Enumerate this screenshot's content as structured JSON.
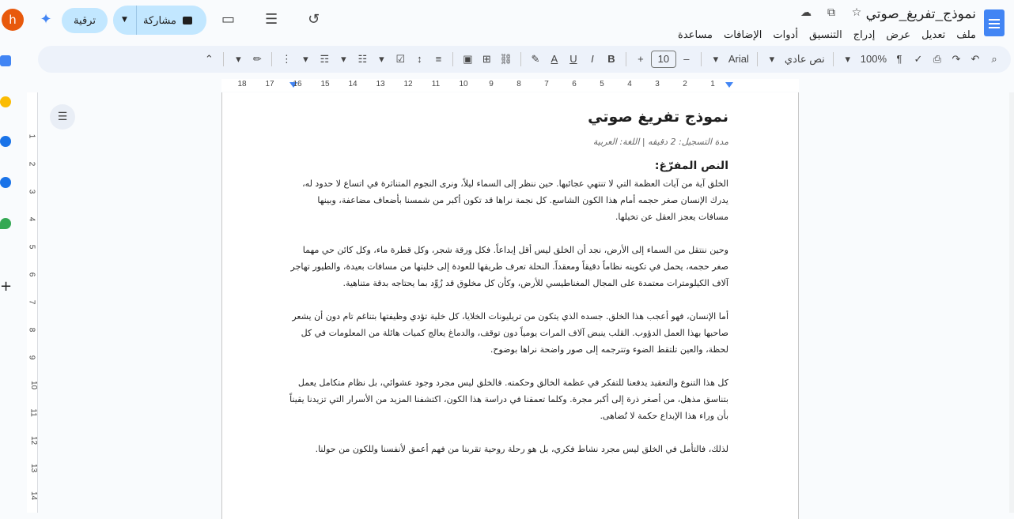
{
  "header": {
    "doc_title": "نموذج_تفريغ_صوتي",
    "menu": [
      "ملف",
      "تعديل",
      "عرض",
      "إدراج",
      "التنسيق",
      "أدوات",
      "الإضافات",
      "مساعدة"
    ],
    "share_label": "مشاركة",
    "upgrade_label": "ترقية",
    "avatar_letter": "h"
  },
  "toolbar": {
    "zoom": "100%",
    "style": "نص عادي",
    "font": "Arial",
    "font_size": "10",
    "bold": "B",
    "italic": "I",
    "underline": "U",
    "text_color": "A",
    "minus": "–",
    "plus": "+"
  },
  "ruler": {
    "h_ticks": [
      "18",
      "17",
      "16",
      "15",
      "14",
      "13",
      "12",
      "11",
      "10",
      "9",
      "8",
      "7",
      "6",
      "5",
      "4",
      "3",
      "2",
      "1"
    ],
    "v_ticks": [
      "1",
      "2",
      "3",
      "4",
      "5",
      "6",
      "7",
      "8",
      "9",
      "10",
      "11",
      "12",
      "13",
      "14"
    ]
  },
  "document": {
    "title": "نموذج تفريغ صوتي",
    "meta": "مدة التسجيل: 2 دقيقه | اللغة: العربية",
    "section_heading": "النص المفرّغ:",
    "paragraphs": [
      "الخلق آية من آيات العظمة التي لا تنتهي عجائبها. حين ننظر إلى السماء ليلاً، ونرى النجوم المتناثرة في اتساع لا حدود له، يدرك الإنسان صغر حجمه أمام هذا الكون الشاسع. كل نجمة نراها قد تكون أكبر من شمسنا بأضعاف مضاعفة، وبينها مسافات يعجز العقل عن تخيلها.",
      "وحين ننتقل من السماء إلى الأرض، نجد أن الخلق ليس أقل إبداعاً. فكل ورقة شجر، وكل قطرة ماء، وكل كائن حي مهما صغر حجمه، يحمل في تكوينه نظاماً دقيقاً ومعقداً. النحلة تعرف طريقها للعودة إلى خليتها من مسافات بعيدة، والطيور تهاجر آلاف الكيلومترات معتمدة على المجال المغناطيسي للأرض، وكأن كل مخلوق قد زُوِّد بما يحتاجه بدقة متناهية.",
      "أما الإنسان، فهو أعجب هذا الخلق. جسده الذي يتكون من تريليونات الخلايا، كل خلية تؤدي وظيفتها بتناغم تام دون أن يشعر صاحبها بهذا العمل الدؤوب. القلب ينبض آلاف المرات يومياً دون توقف، والدماغ يعالج كميات هائلة من المعلومات في كل لحظة، والعين تلتقط الضوء وتترجمه إلى صور واضحة نراها بوضوح.",
      "كل هذا التنوع والتعقيد يدفعنا للتفكر في عظمة الخالق وحكمته. فالخلق ليس مجرد وجود عشوائي، بل نظام متكامل يعمل بتناسق مذهل، من أصغر ذرة إلى أكبر مجرة. وكلما تعمقنا في دراسة هذا الكون، اكتشفنا المزيد من الأسرار التي تزيدنا يقيناً بأن وراء هذا الإبداع حكمة لا تُضاهى.",
      "لذلك، فالتأمل في الخلق ليس مجرد نشاط فكري، بل هو رحلة روحية تقربنا من فهم أعمق لأنفسنا وللكون من حولنا."
    ]
  },
  "colors": {
    "accent": "#4285f4",
    "share_bg": "#c2e7ff",
    "toolbar_bg": "#edf2fa",
    "avatar": "#e8590c"
  }
}
